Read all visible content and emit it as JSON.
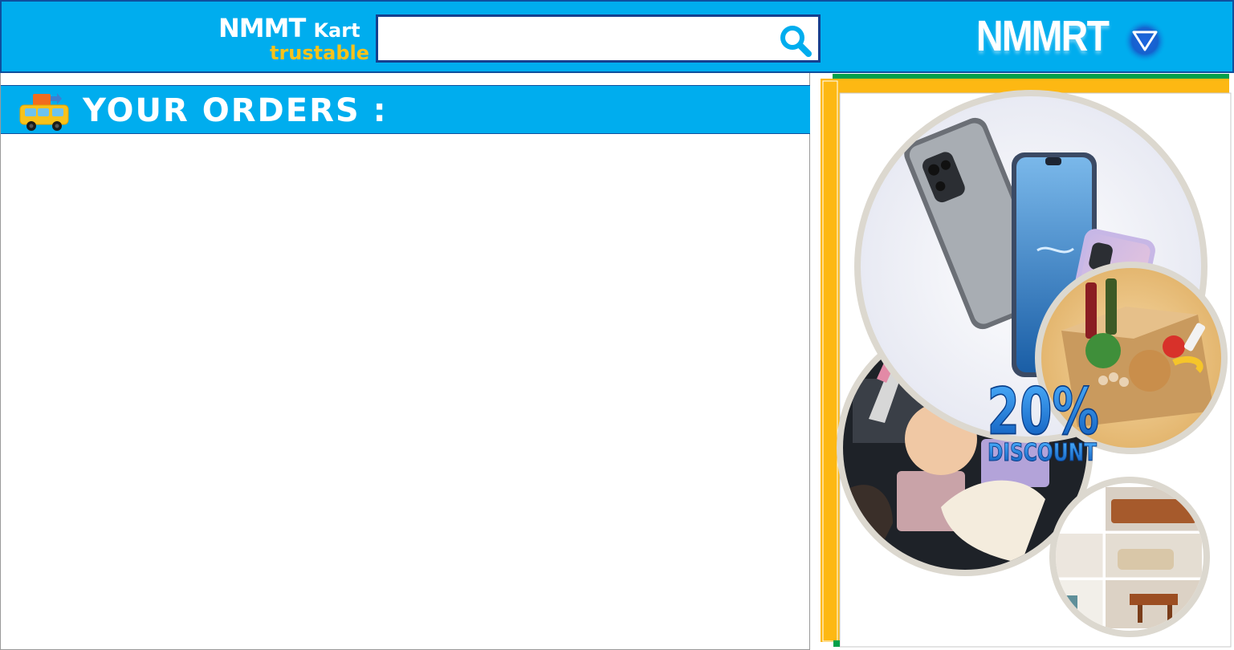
{
  "header": {
    "logo_main": "NMMT",
    "logo_kart": "Kart",
    "logo_tagline": "trustable",
    "search": {
      "placeholder": "",
      "value": ""
    },
    "brand": "NMMRT"
  },
  "orders": {
    "title": "YOUR ORDERS :",
    "items": []
  },
  "promo": {
    "discount_number": "20%",
    "discount_word": "DISCOUNT"
  },
  "colors": {
    "header_bg": "#00adee",
    "header_border": "#0e4f9e",
    "logo_tagline": "#f8c21a",
    "promo_frame": "#fdb813"
  },
  "icons": {
    "search": "search-icon",
    "dropdown": "triangle-down-icon",
    "orders": "delivery-truck-icon"
  }
}
